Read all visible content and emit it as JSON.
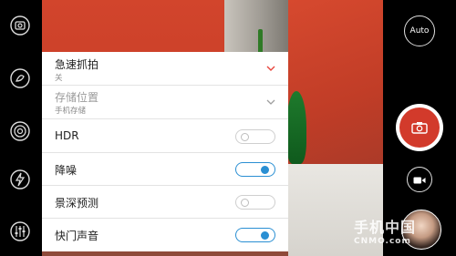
{
  "right_bar": {
    "auto_label": "Auto"
  },
  "settings": {
    "rows": [
      {
        "label": "急速抓拍",
        "sub": "关",
        "control": "dropdown",
        "chevron_color": "#e8453c"
      },
      {
        "label": "存储位置",
        "sub": "手机存储",
        "control": "dropdown",
        "chevron_color": "#9e9e9e"
      },
      {
        "label": "HDR",
        "control": "toggle",
        "state": "off"
      },
      {
        "label": "降噪",
        "control": "toggle",
        "state": "on"
      },
      {
        "label": "景深预测",
        "control": "toggle",
        "state": "off"
      },
      {
        "label": "快门声音",
        "control": "toggle",
        "state": "on"
      }
    ]
  },
  "watermark": {
    "cn": "手机中国",
    "en": "CNMO.com"
  },
  "icons": {
    "left_bar": [
      "camera-settings-icon",
      "beauty-icon",
      "lens-mode-icon",
      "flash-icon",
      "settings-sliders-icon"
    ],
    "right_bar": [
      "auto-mode-icon",
      "camera-shutter-icon",
      "video-icon",
      "gallery-thumbnail"
    ]
  },
  "colors": {
    "accent": "#2a8fd3",
    "shutter_red": "#d23a2b",
    "panel_bg": "#ffffff"
  }
}
